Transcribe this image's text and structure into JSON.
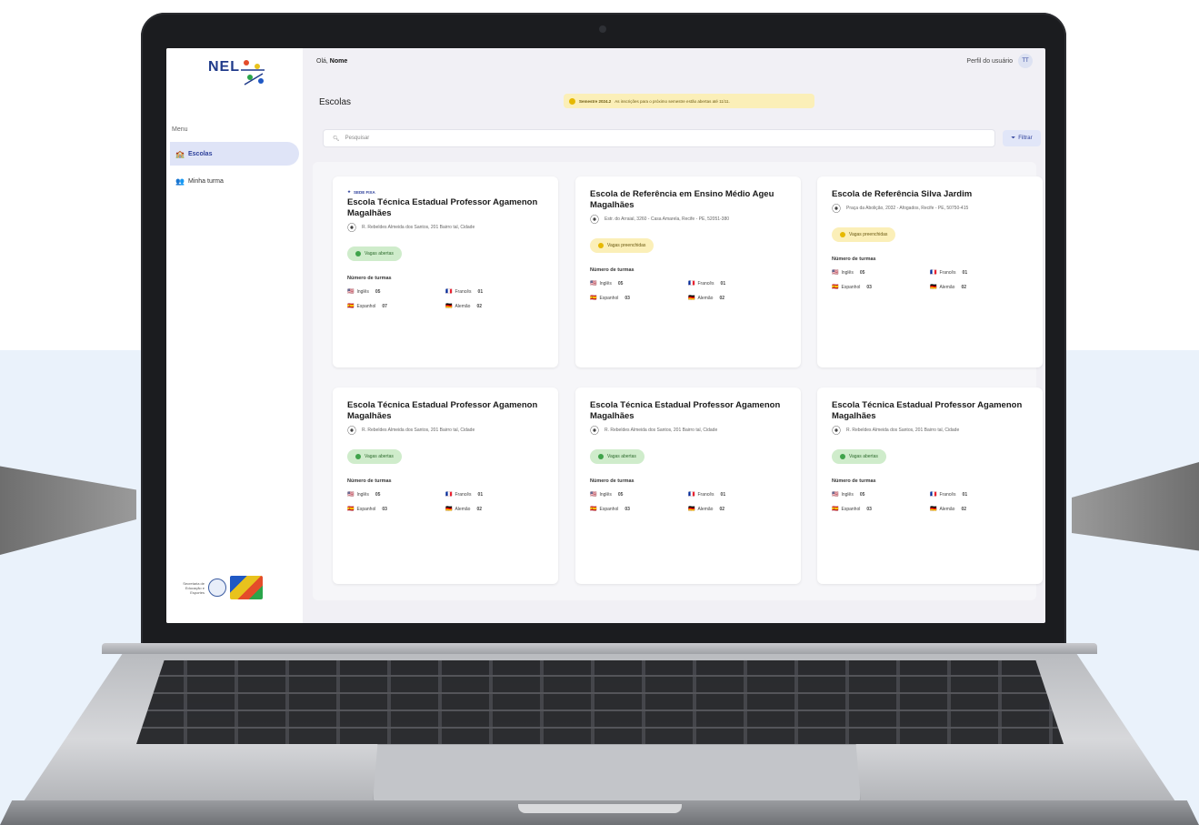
{
  "app": {
    "logo_text": "NEL",
    "menu_label": "Menu",
    "nav": [
      {
        "icon": "school-icon",
        "label": "Escolas"
      },
      {
        "icon": "team-icon",
        "label": "Minha turma"
      }
    ],
    "user_greeting": "Olá,",
    "user_name": "Nome",
    "profile_label": "Perfil do usuário",
    "avatar_initials": "TT",
    "page_title": "Escolas",
    "notice_title": "Semestre 2024.2",
    "notice_text": "As inscrições para o próximo semestre estão abertas até 11/11.",
    "search_placeholder": "Pesquisar",
    "filter_label": "Filtrar",
    "footer_text": "Secretaria de Educação e Esportes",
    "colors": {
      "accent": "#2c3f9a",
      "open": "#3fa34a",
      "pending": "#e6b800"
    }
  },
  "cards": [
    {
      "tag": "SEDE FIXA",
      "title": "Escola Técnica Estadual Professor Agamenon Magalhães",
      "address": "R. Rebeldes Almeida dos Santos, 201 Bairro tal, Cidade",
      "status": "Vagas abertas",
      "section": "Número de turmas",
      "langs": [
        {
          "flag": "🇺🇸",
          "name": "Inglês",
          "count": "05"
        },
        {
          "flag": "🇫🇷",
          "name": "Francês",
          "count": "01"
        },
        {
          "flag": "🇪🇸",
          "name": "Espanhol",
          "count": "07"
        },
        {
          "flag": "🇩🇪",
          "name": "Alemão",
          "count": "02"
        }
      ]
    },
    {
      "tag": "",
      "title": "Escola de Referência em Ensino Médio Ageu Magalhães",
      "address": "Estr. do Arraial, 3260 - Casa Amarela, Recife - PE, 52051-380",
      "status": "Vagas preenchidas",
      "section": "Número de turmas",
      "langs": [
        {
          "flag": "🇺🇸",
          "name": "Inglês",
          "count": "05"
        },
        {
          "flag": "🇫🇷",
          "name": "Francês",
          "count": "01"
        },
        {
          "flag": "🇪🇸",
          "name": "Espanhol",
          "count": "03"
        },
        {
          "flag": "🇩🇪",
          "name": "Alemão",
          "count": "02"
        }
      ]
    },
    {
      "tag": "",
      "title": "Escola de Referência Silva Jardim",
      "address": "Praça da Abolição, 2032 - Afogados, Recife - PE, 50750-415",
      "status": "Vagas preenchidas",
      "section": "Número de turmas",
      "langs": [
        {
          "flag": "🇺🇸",
          "name": "Inglês",
          "count": "05"
        },
        {
          "flag": "🇫🇷",
          "name": "Francês",
          "count": "01"
        },
        {
          "flag": "🇪🇸",
          "name": "Espanhol",
          "count": "03"
        },
        {
          "flag": "🇩🇪",
          "name": "Alemão",
          "count": "02"
        }
      ]
    },
    {
      "tag": "",
      "title": "Escola Técnica Estadual Professor Agamenon Magalhães",
      "address": "R. Rebeldes Almeida dos Santos, 201 Bairro tal, Cidade",
      "status": "Vagas abertas",
      "section": "Número de turmas",
      "langs": [
        {
          "flag": "🇺🇸",
          "name": "Inglês",
          "count": "05"
        },
        {
          "flag": "🇫🇷",
          "name": "Francês",
          "count": "01"
        },
        {
          "flag": "🇪🇸",
          "name": "Espanhol",
          "count": "03"
        },
        {
          "flag": "🇩🇪",
          "name": "Alemão",
          "count": "02"
        }
      ]
    },
    {
      "tag": "",
      "title": "Escola Técnica Estadual Professor Agamenon Magalhães",
      "address": "R. Rebeldes Almeida dos Santos, 201 Bairro tal, Cidade",
      "status": "Vagas abertas",
      "section": "Número de turmas",
      "langs": [
        {
          "flag": "🇺🇸",
          "name": "Inglês",
          "count": "05"
        },
        {
          "flag": "🇫🇷",
          "name": "Francês",
          "count": "01"
        },
        {
          "flag": "🇪🇸",
          "name": "Espanhol",
          "count": "03"
        },
        {
          "flag": "🇩🇪",
          "name": "Alemão",
          "count": "02"
        }
      ]
    },
    {
      "tag": "",
      "title": "Escola Técnica Estadual Professor Agamenon Magalhães",
      "address": "R. Rebeldes Almeida dos Santos, 201 Bairro tal, Cidade",
      "status": "Vagas abertas",
      "section": "Número de turmas",
      "langs": [
        {
          "flag": "🇺🇸",
          "name": "Inglês",
          "count": "05"
        },
        {
          "flag": "🇫🇷",
          "name": "Francês",
          "count": "01"
        },
        {
          "flag": "🇪🇸",
          "name": "Espanhol",
          "count": "03"
        },
        {
          "flag": "🇩🇪",
          "name": "Alemão",
          "count": "02"
        }
      ]
    }
  ]
}
